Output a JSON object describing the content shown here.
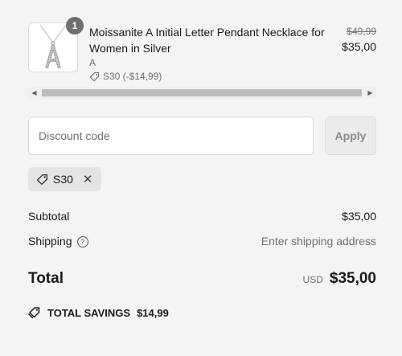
{
  "product": {
    "quantity": "1",
    "name": "Moissanite A Initial Letter Pendant Necklace for Women in Silver",
    "variant": "A",
    "discount_line": "S30 (-$14,99)",
    "old_price": "$49,99",
    "price": "$35,00",
    "thumbnail_icon": "pendant-letter-a-image"
  },
  "discount": {
    "placeholder": "Discount code",
    "value": "",
    "apply_label": "Apply",
    "applied_code": "S30"
  },
  "summary": {
    "subtotal_label": "Subtotal",
    "subtotal_value": "$35,00",
    "shipping_label": "Shipping",
    "shipping_value": "Enter shipping address",
    "total_label": "Total",
    "currency": "USD",
    "total_value": "$35,00",
    "savings_label": "TOTAL SAVINGS",
    "savings_value": "$14,99"
  },
  "colors": {
    "background": "#f4f4f4",
    "muted_text": "#707070",
    "badge": "#6f6f6f",
    "chip": "#e4e4e4"
  }
}
